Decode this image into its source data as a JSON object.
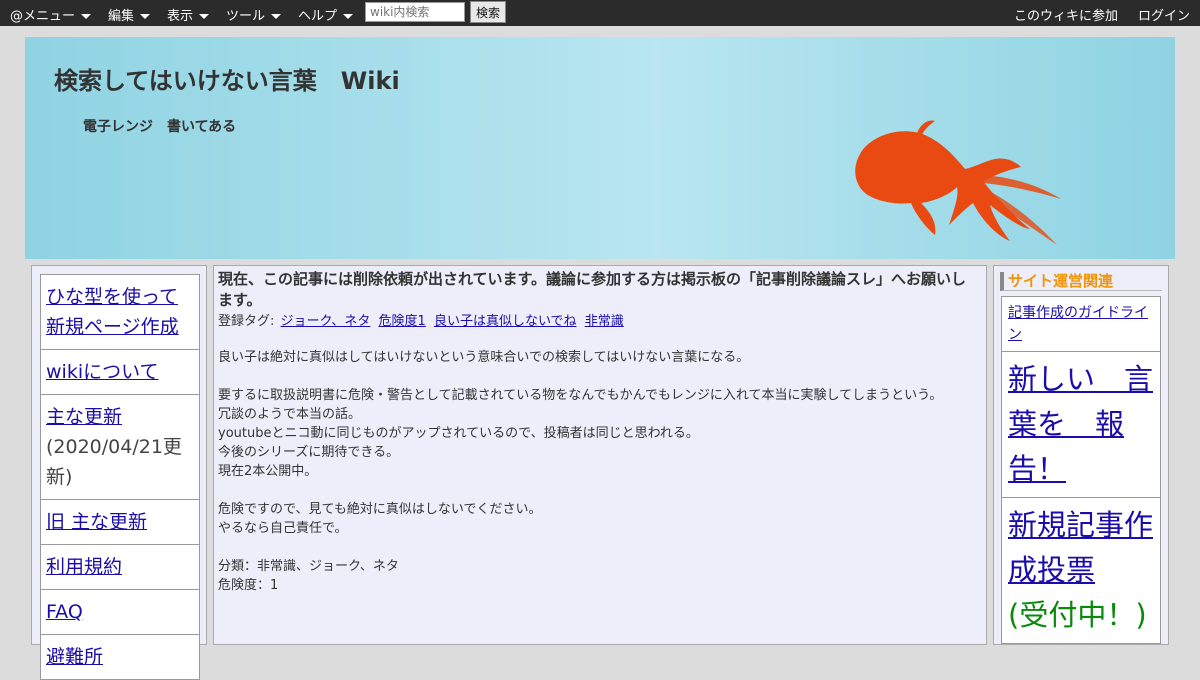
{
  "topbar": {
    "menu_label": "@メニュー",
    "edit_label": "編集",
    "view_label": "表示",
    "tools_label": "ツール",
    "help_label": "ヘルプ",
    "search_placeholder": "wiki内検索",
    "search_button": "検索",
    "join_label": "このウィキに参加",
    "login_label": "ログイン"
  },
  "banner": {
    "title": "検索してはいけない言葉　Wiki",
    "subtitle": "電子レンジ　書いてある",
    "accent_color": "#e84a12"
  },
  "left_menu": {
    "items": [
      {
        "label": "ひな型を使って新規ページ作成"
      },
      {
        "label": "wikiについて"
      },
      {
        "label": "主な更新",
        "note": "(2020/04/21更新)"
      },
      {
        "label": "旧 主な更新"
      },
      {
        "label": "利用規約"
      },
      {
        "label": "FAQ"
      },
      {
        "label": "避難所"
      }
    ]
  },
  "article": {
    "notice": "現在、この記事には削除依頼が出されています。議論に参加する方は掲示板の「記事削除議論スレ」へお願いします。",
    "tags_label": "登録タグ:",
    "tags": [
      "ジョーク、ネタ",
      "危険度1",
      "良い子は真似しないでね",
      "非常識"
    ],
    "paragraphs": [
      "良い子は絶対に真似はしてはいけないという意味合いでの検索してはいけない言葉になる。",
      "要するに取扱説明書に危険・警告として記載されている物をなんでもかんでもレンジに入れて本当に実験してしまうという。",
      "冗談のようで本当の話。",
      "youtubeとニコ動に同じものがアップされているので、投稿者は同じと思われる。",
      "今後のシリーズに期待できる。",
      "現在2本公開中。",
      "危険ですので、見ても絶対に真似はしないでください。",
      "やるなら自己責任で。",
      "分類：非常識、ジョーク、ネタ",
      "危険度：1"
    ]
  },
  "right_sidebar": {
    "heading": "サイト運営関連",
    "heading_color": "#f0940a",
    "items": [
      {
        "label": "記事作成のガイドライン"
      },
      {
        "label": "新しい　言葉を　報告！"
      },
      {
        "label": "新規記事作成投票",
        "note": "(受付中！)"
      }
    ]
  }
}
